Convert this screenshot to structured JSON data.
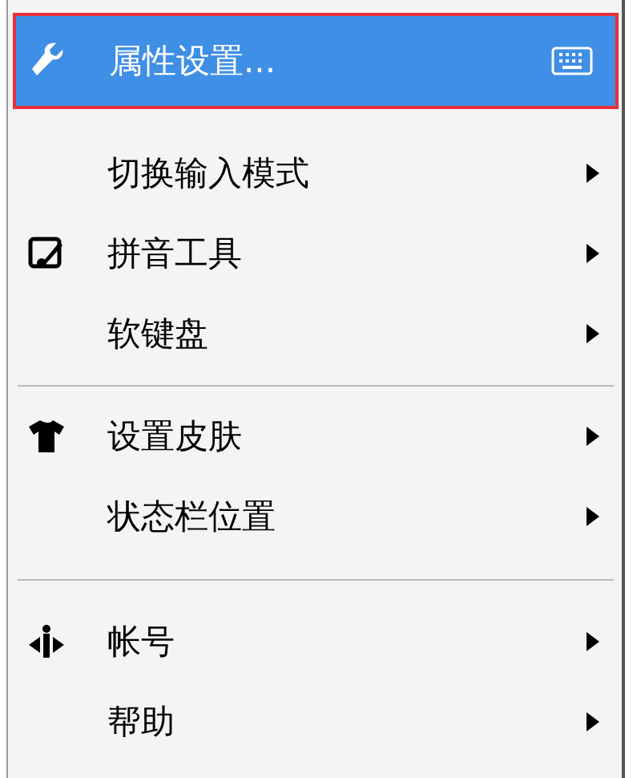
{
  "menu": {
    "items": [
      {
        "kind": "item",
        "label": "属性设置...",
        "submenu": false,
        "selected": true
      },
      {
        "kind": "item",
        "label": "切换输入模式",
        "submenu": true,
        "selected": false
      },
      {
        "kind": "item",
        "label": "拼音工具",
        "submenu": true,
        "selected": false
      },
      {
        "kind": "item",
        "label": "软键盘",
        "submenu": true,
        "selected": false
      },
      {
        "kind": "separator"
      },
      {
        "kind": "item",
        "label": "设置皮肤",
        "submenu": true,
        "selected": false
      },
      {
        "kind": "item",
        "label": "状态栏位置",
        "submenu": true,
        "selected": false
      },
      {
        "kind": "separator"
      },
      {
        "kind": "item",
        "label": "帐号",
        "submenu": true,
        "selected": false
      },
      {
        "kind": "item",
        "label": "帮助",
        "submenu": true,
        "selected": false
      }
    ]
  }
}
